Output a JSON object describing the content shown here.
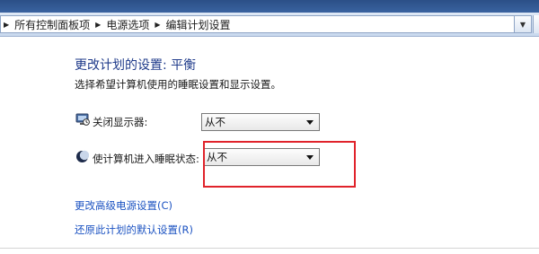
{
  "breadcrumb": {
    "items": [
      "所有控制面板项",
      "电源选项",
      "编辑计划设置"
    ]
  },
  "page": {
    "title": "更改计划的设置: 平衡",
    "subtitle": "选择希望计算机使用的睡眠设置和显示设置。"
  },
  "settings": {
    "display_off": {
      "label": "关闭显示器:",
      "value": "从不"
    },
    "sleep": {
      "label": "使计算机进入睡眠状态:",
      "value": "从不"
    }
  },
  "links": {
    "advanced": "更改高级电源设置(C)",
    "restore": "还原此计划的默认设置(R)"
  },
  "colors": {
    "title": "#1e3a8a",
    "link": "#1c53c2",
    "highlight": "#e0232b"
  }
}
